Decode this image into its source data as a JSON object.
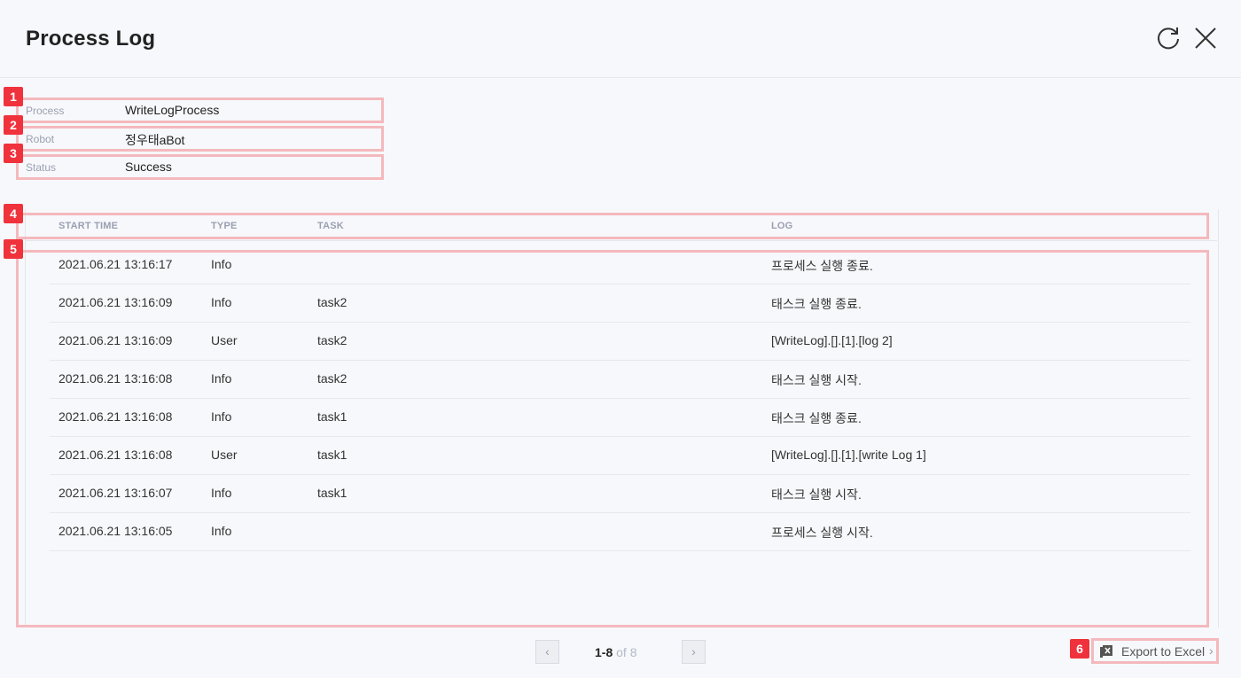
{
  "dialog": {
    "title": "Process Log"
  },
  "info": [
    {
      "label": "Process",
      "value": "WriteLogProcess"
    },
    {
      "label": "Robot",
      "value": "정우태aBot"
    },
    {
      "label": "Status",
      "value": "Success"
    }
  ],
  "table": {
    "columns": [
      "START TIME",
      "TYPE",
      "TASK",
      "LOG"
    ],
    "rows": [
      {
        "start_time": "2021.06.21 13:16:17",
        "type": "Info",
        "task": "",
        "log": "프로세스 실행 종료."
      },
      {
        "start_time": "2021.06.21 13:16:09",
        "type": "Info",
        "task": "task2",
        "log": "태스크 실행 종료."
      },
      {
        "start_time": "2021.06.21 13:16:09",
        "type": "User",
        "task": "task2",
        "log": "[WriteLog].[].[1].[log 2]"
      },
      {
        "start_time": "2021.06.21 13:16:08",
        "type": "Info",
        "task": "task2",
        "log": "태스크 실행 시작."
      },
      {
        "start_time": "2021.06.21 13:16:08",
        "type": "Info",
        "task": "task1",
        "log": "태스크 실행 종료."
      },
      {
        "start_time": "2021.06.21 13:16:08",
        "type": "User",
        "task": "task1",
        "log": "[WriteLog].[].[1].[write Log 1]"
      },
      {
        "start_time": "2021.06.21 13:16:07",
        "type": "Info",
        "task": "task1",
        "log": "태스크 실행 시작."
      },
      {
        "start_time": "2021.06.21 13:16:05",
        "type": "Info",
        "task": "",
        "log": "프로세스 실행 시작."
      }
    ]
  },
  "pagination": {
    "range": "1-8",
    "of_label": "of",
    "total": "8",
    "prev_icon": "chevron-left-icon",
    "next_icon": "chevron-right-icon"
  },
  "export": {
    "label": "Export to Excel",
    "icon": "excel-icon"
  },
  "badges": [
    "1",
    "2",
    "3",
    "4",
    "5",
    "6"
  ],
  "colors": {
    "badge": "#f0323c",
    "highlight_outline": "#f4b9bd",
    "background": "#f7f8fb"
  }
}
